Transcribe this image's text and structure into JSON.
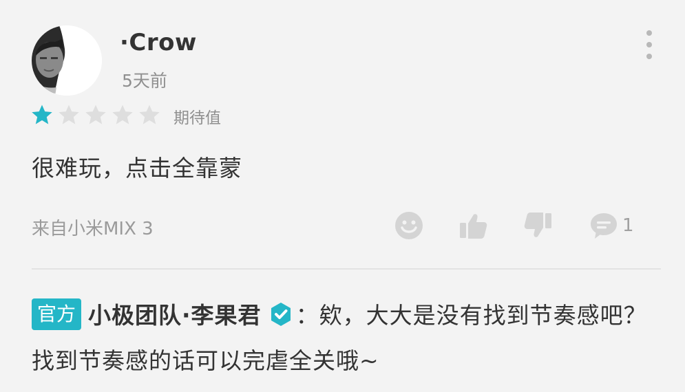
{
  "user": {
    "name": "·Crow",
    "time": "5天前",
    "avatar_icon": "person-photo-avatar"
  },
  "rating": {
    "stars_filled": 1,
    "stars_total": 5,
    "label": "期待值",
    "filled_color": "#24b6c7",
    "empty_color": "#dedede"
  },
  "review": {
    "text": "很难玩，点击全靠蒙"
  },
  "footer": {
    "device": "来自小米MIX 3",
    "actions": [
      {
        "icon": "smiley-icon"
      },
      {
        "icon": "thumbs-up-icon"
      },
      {
        "icon": "thumbs-down-icon"
      },
      {
        "icon": "comment-icon",
        "count": "1"
      }
    ]
  },
  "reply": {
    "badge": "官方",
    "author": "小极团队·李果君",
    "verified_icon": "verified-shield-icon",
    "text": "：欸，大大是没有找到节奏感吧？找到节奏感的话可以完虐全关哦~"
  },
  "colors": {
    "accent": "#24b6c7",
    "icon_gray": "#d4d4d4"
  }
}
